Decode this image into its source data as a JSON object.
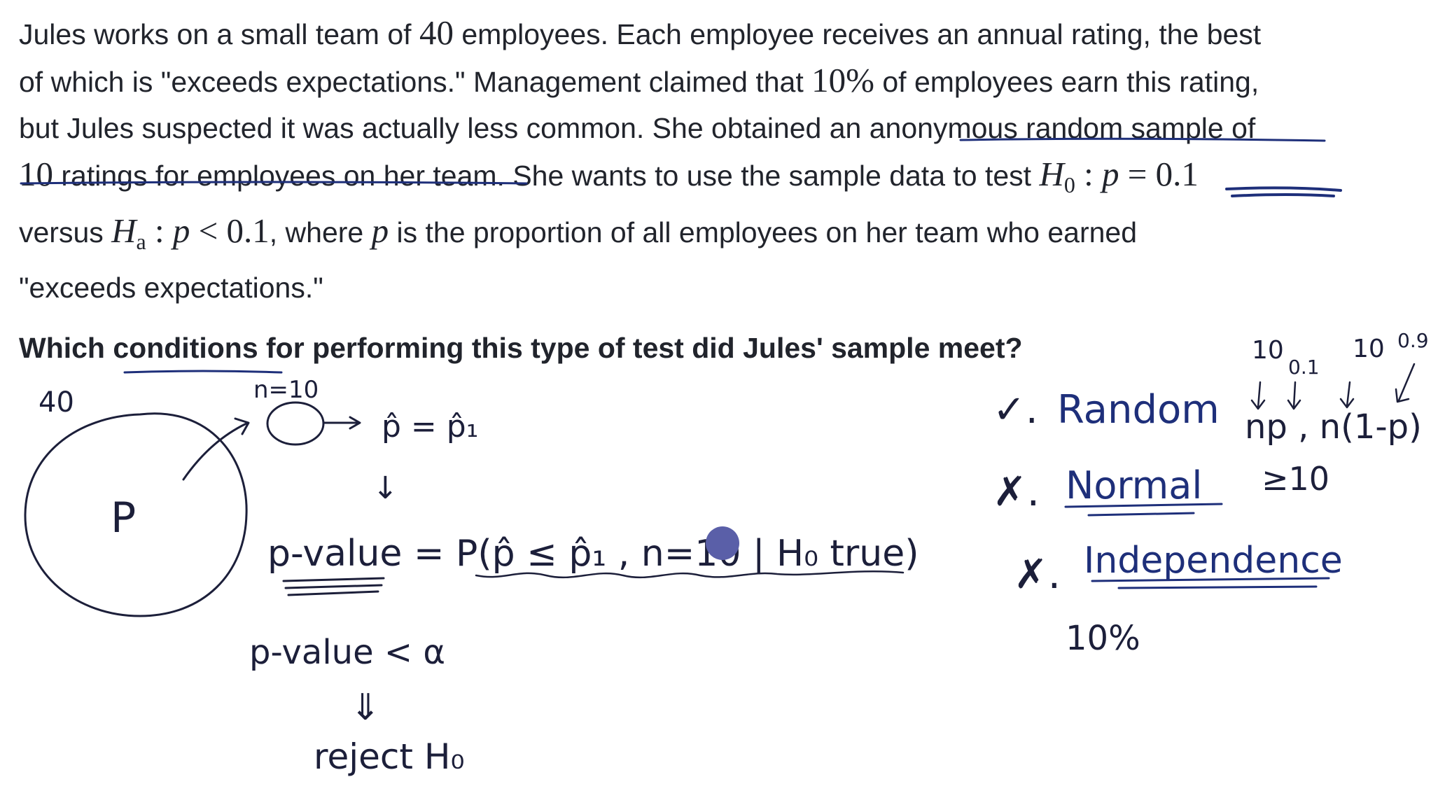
{
  "problem": {
    "line1": {
      "a": "Jules works on a small team of ",
      "m1": "40",
      "b": " employees. Each employee receives an annual rating, the best"
    },
    "line2": {
      "a": "of which is \"exceeds expectations.\" Management claimed that ",
      "m1": "10%",
      "b": " of employees earn this rating,"
    },
    "line3": {
      "a": "but Jules suspected it was actually less common. She obtained an ",
      "u": "anonymous random sample",
      "b": " of"
    },
    "line4": {
      "m1": "10",
      "a": " ratings for employees on her team",
      "b": ". She wants to use the sample data to test ",
      "h": "H",
      "hsub": "0",
      "c": " : ",
      "p": "p",
      "d": " = 0.1"
    },
    "line5": {
      "a": "versus ",
      "h": "H",
      "hsub": "a",
      "c": " : ",
      "p": "p",
      "d": " < 0.1",
      "e": ", where ",
      "p2": "p",
      "f": " is the proportion of all employees on her team who earned"
    },
    "line6": {
      "a": "\"exceeds expectations.\""
    }
  },
  "question": {
    "a": "Which ",
    "u": "conditions",
    "b": " for performing this type of test did Jules' sample meet?"
  },
  "annotations": {
    "population_size": "40",
    "population_param": "P",
    "sample_size": "n=10",
    "phat_eq": "p̂ = p̂₁",
    "down_arrow": "↓",
    "pvalue_formula": "p-value = P(p̂ ≤ p̂₁ , n=10 | H₀ true)",
    "pvalue_compare": "p-value < α",
    "double_arrow": "⇓",
    "reject": "reject H₀",
    "check_random": "✓.",
    "random": "Random",
    "cross_normal": "✗.",
    "normal": "Normal",
    "cross_indep": "✗.",
    "independence": "Independence",
    "ten_percent": "10%",
    "top_10a": "10",
    "top_01": "0.1",
    "top_10b": "10",
    "top_09": "0.9",
    "np_expr": "np , n(1-p)",
    "geq_ten": "≥10"
  },
  "colors": {
    "text": "#21242c",
    "ink_dark": "#1c1f3a",
    "ink_blue": "#1e2f7a",
    "cursor": "#5a5fa8"
  }
}
